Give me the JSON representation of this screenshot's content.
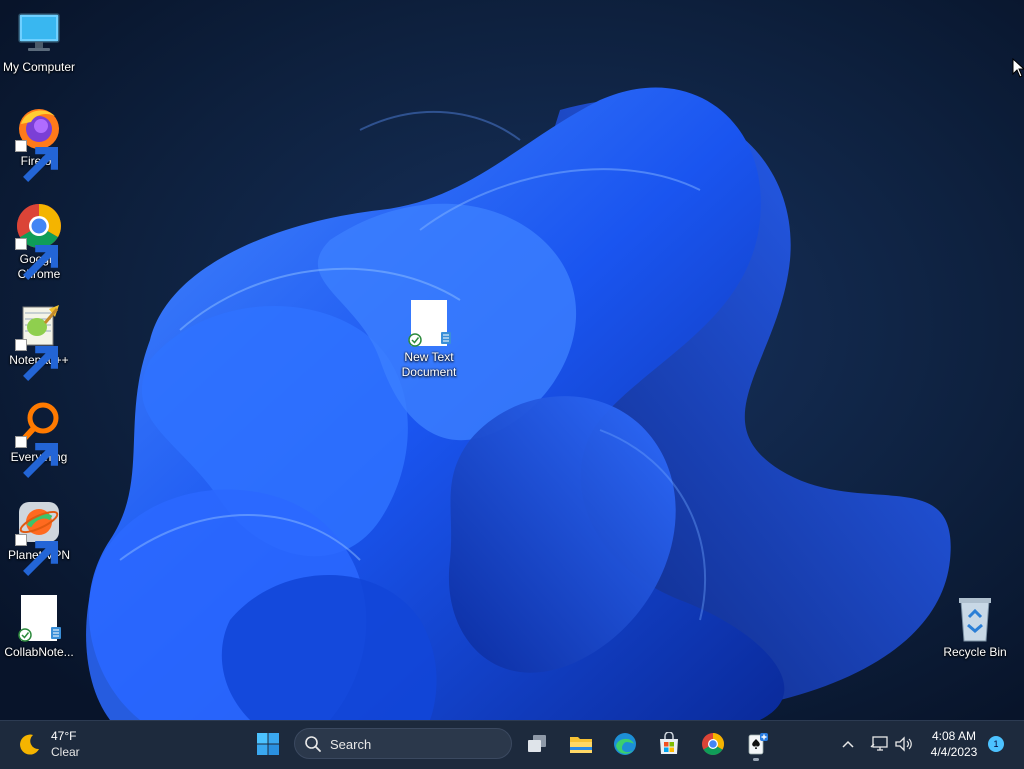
{
  "desktop": {
    "icons": [
      {
        "label": "My Computer",
        "icon": "monitor-icon"
      },
      {
        "label": "Firefox",
        "icon": "firefox-icon"
      },
      {
        "label": "Google Chrome",
        "icon": "chrome-icon"
      },
      {
        "label": "Notepad++",
        "icon": "notepadpp-icon"
      },
      {
        "label": "Everything",
        "icon": "everything-search-icon"
      },
      {
        "label": "Planet VPN",
        "icon": "planet-vpn-icon"
      },
      {
        "label": "CollabNote...",
        "icon": "text-file-icon"
      },
      {
        "label": "New Text Document",
        "icon": "text-file-icon"
      },
      {
        "label": "Recycle Bin",
        "icon": "recycle-bin-icon"
      }
    ]
  },
  "taskbar": {
    "weather": {
      "temp": "47°F",
      "condition": "Clear",
      "icon": "moon-icon"
    },
    "search_placeholder": "Search",
    "pinned": [
      {
        "name": "start",
        "icon": "windows-logo-icon"
      },
      {
        "name": "task-view",
        "icon": "task-view-icon"
      },
      {
        "name": "file-explorer",
        "icon": "folder-icon"
      },
      {
        "name": "edge",
        "icon": "edge-icon"
      },
      {
        "name": "microsoft-store",
        "icon": "store-icon"
      },
      {
        "name": "chrome",
        "icon": "chrome-icon"
      },
      {
        "name": "solitaire",
        "icon": "solitaire-icon"
      }
    ],
    "clock": {
      "time": "4:08 AM",
      "date": "4/4/2023"
    },
    "notification_count": "1"
  },
  "colors": {
    "taskbar_bg": "#1d2a3d",
    "accent": "#4cc2ff",
    "wallpaper_blue": "#1f5cff"
  }
}
